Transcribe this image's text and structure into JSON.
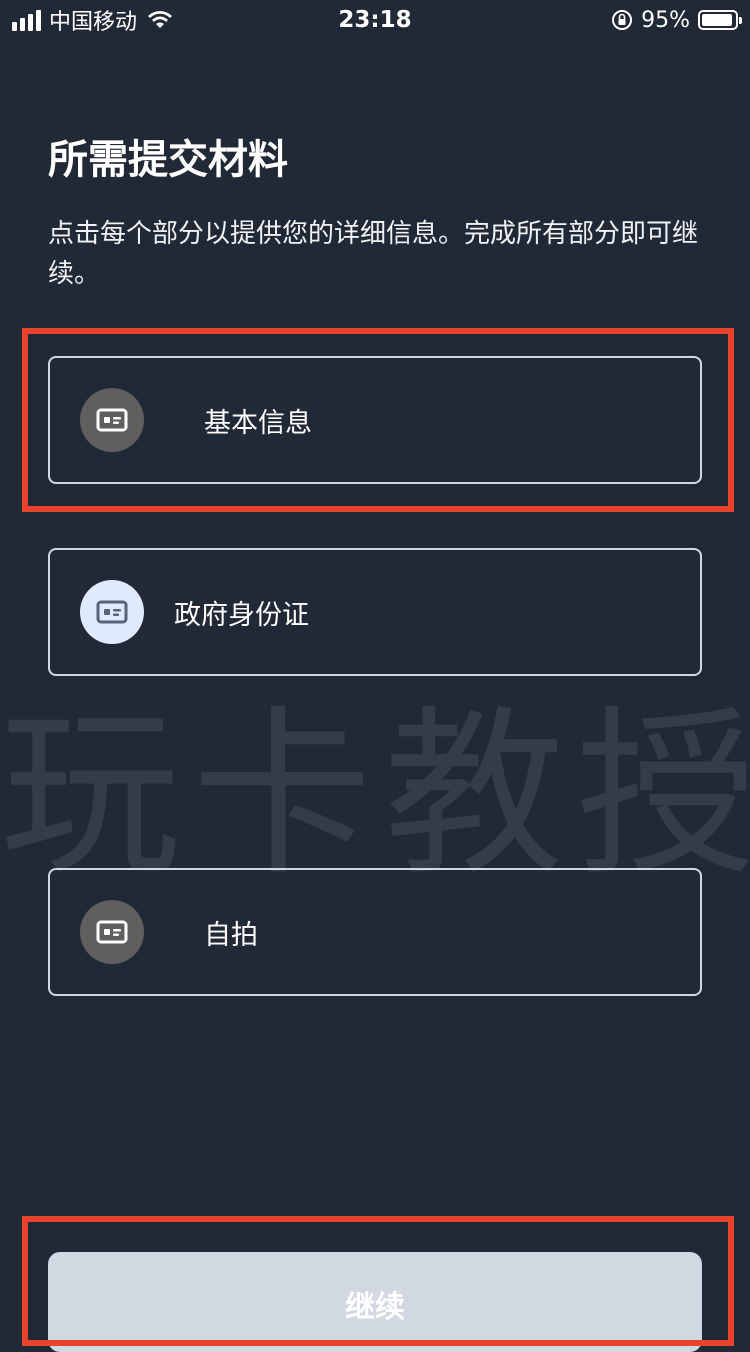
{
  "status_bar": {
    "carrier": "中国移动",
    "time": "23:18",
    "battery_percent": "95%",
    "battery_level": 0.95,
    "icons": [
      "signal-icon",
      "wifi-icon",
      "rotation-lock-icon",
      "battery-icon"
    ]
  },
  "header": {
    "title": "所需提交材料",
    "subtitle": "点击每个部分以提供您的详细信息。完成所有部分即可继续。"
  },
  "sections": [
    {
      "label": "基本信息",
      "icon": "id-card-icon",
      "state": "done"
    },
    {
      "label": "政府身份证",
      "icon": "id-card-icon",
      "state": "active"
    },
    {
      "label": "自拍",
      "icon": "id-card-icon",
      "state": "done"
    }
  ],
  "watermark": "玩卡教授",
  "footer": {
    "continue_label": "继续"
  },
  "colors": {
    "background": "#212836",
    "highlight": "#e8432d",
    "button_disabled": "#d2d8e2",
    "icon_done_bg": "#5f5f5f",
    "icon_active_bg": "#dfeaff"
  }
}
